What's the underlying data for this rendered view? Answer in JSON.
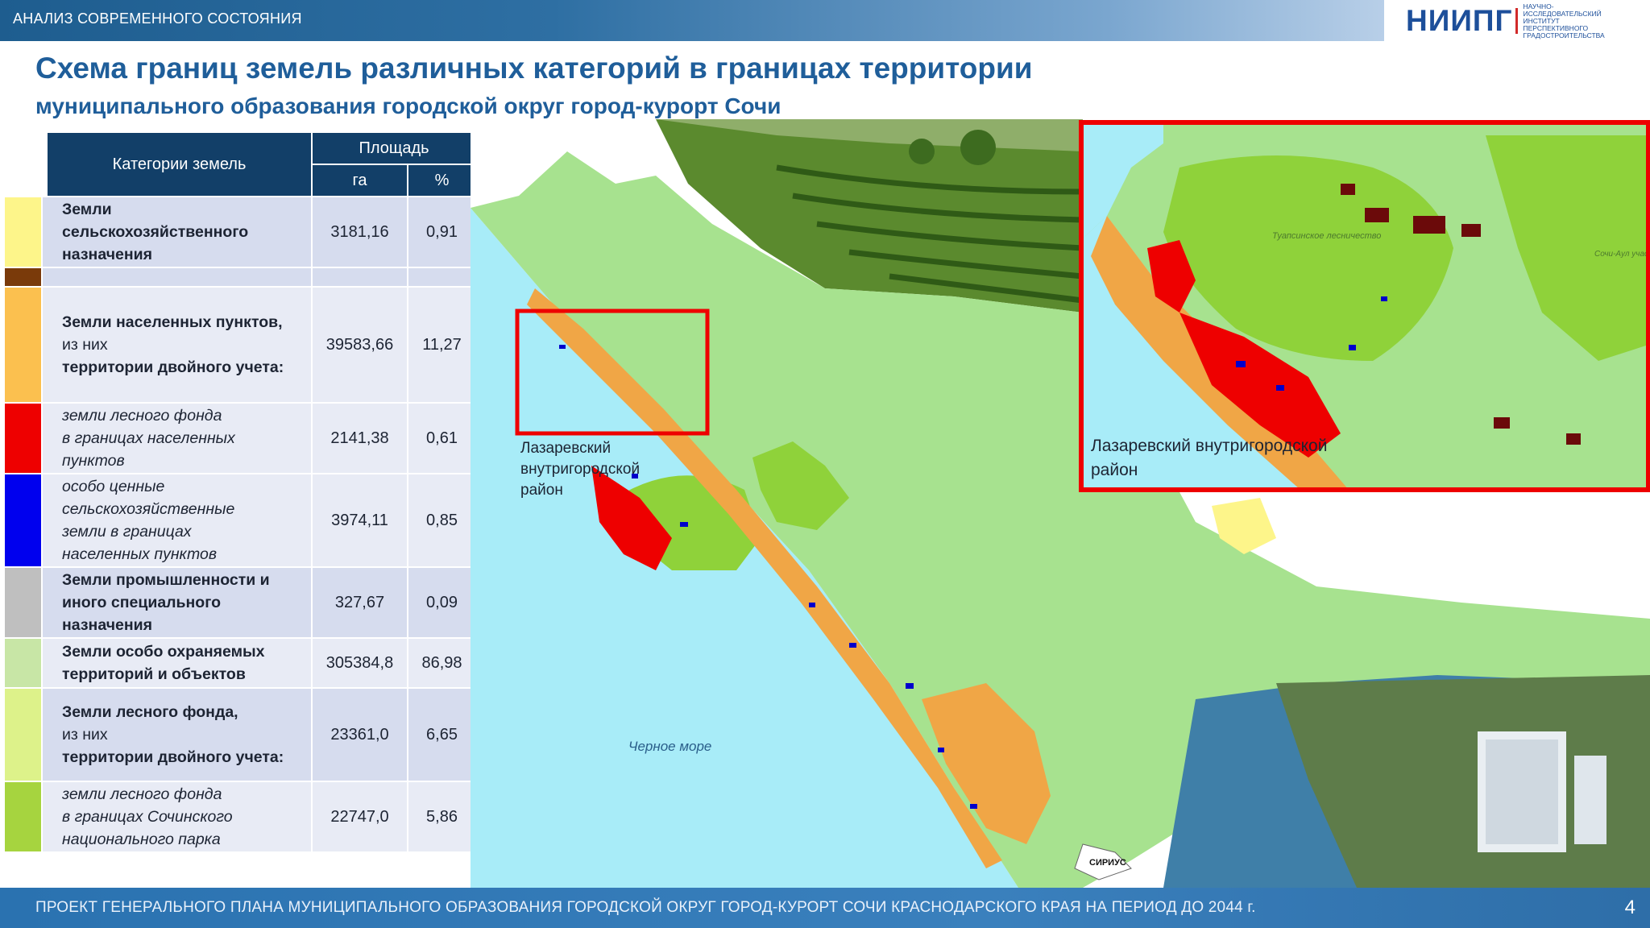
{
  "header": {
    "section": "АНАЛИЗ СОВРЕМЕННОГО СОСТОЯНИЯ",
    "logo_mark": "НИИПГ",
    "logo_desc": "НАУЧНО-ИССЛЕДОВАТЕЛЬСКИЙ ИНСТИТУТ ПЕРСПЕКТИВНОГО ГРАДОСТРОИТЕЛЬСТВА"
  },
  "title": {
    "line1": "Схема границ земель различных категорий в границах территории",
    "line2": "муниципального образования городской округ город-курорт Сочи"
  },
  "table": {
    "col_category": "Категории земель",
    "col_area": "Площадь",
    "col_ha": "га",
    "col_pct": "%",
    "rows": [
      {
        "color": "#fdf58a",
        "l1": "Земли",
        "l2": "сельскохозяйственного",
        "l3": "назначения",
        "l4": "",
        "ha": "3181,16",
        "pct": "0,91"
      },
      {
        "color": "#7a3a0a",
        "l1": "",
        "l2": "",
        "l3": "",
        "l4": "",
        "ha": "",
        "pct": ""
      },
      {
        "color": "#fbc04f",
        "l1": "Земли населенных пунктов,",
        "l2": "из них",
        "l3": "территории двойного учета:",
        "l4": "",
        "ha": "39583,66",
        "pct": "11,27"
      },
      {
        "color": "#ee0000",
        "l1": "земли лесного фонда",
        "l2": "в границах населенных",
        "l3": "пунктов",
        "l4": "",
        "ha": "2141,38",
        "pct": "0,61"
      },
      {
        "color": "#0000ee",
        "l1": "особо ценные",
        "l2": "сельскохозяйственные",
        "l3": "земли в границах",
        "l4": "населенных пунктов",
        "ha": "3974,11",
        "pct": "0,85"
      },
      {
        "color": "#bfbfbf",
        "l1": "Земли промышленности и",
        "l2": "иного специального",
        "l3": "назначения",
        "l4": "",
        "ha": "327,67",
        "pct": "0,09"
      },
      {
        "color": "#c8e6a6",
        "l1": "Земли особо охраняемых",
        "l2": "территорий и объектов",
        "l3": "",
        "l4": "",
        "ha": "305384,8",
        "pct": "86,98"
      },
      {
        "color": "#ddf28a",
        "l1": "Земли лесного фонда,",
        "l2": "из них",
        "l3": "территории двойного учета:",
        "l4": "",
        "ha": "23361,0",
        "pct": "6,65"
      },
      {
        "color": "#a6d43f",
        "l1": "земли лесного фонда",
        "l2": "в границах Сочинского",
        "l3": "национального парка",
        "l4": "",
        "ha": "22747,0",
        "pct": "5,86"
      }
    ]
  },
  "map": {
    "sea_label": "Черное море",
    "district_label_l1": "Лазаревский",
    "district_label_l2": "внутригородской",
    "district_label_l3": "район",
    "inset_label_l1": "Лазаревский внутригородской",
    "inset_label_l2": "район",
    "inset_place1": "Туапсинское лесничество",
    "inset_place2": "Сочи-Аул участковое",
    "sirius_label": "СИРИУС",
    "colors": {
      "sea": "#a8ecf8",
      "protected": "#a7e28f",
      "forest": "#8fd23a",
      "settlement": "#f0a646",
      "forest_in_settlement": "#ee0000",
      "agri_valuable": "#0000cc",
      "frame": "#ee0000"
    }
  },
  "footer": {
    "text": "ПРОЕКТ ГЕНЕРАЛЬНОГО ПЛАНА  МУНИЦИПАЛЬНОГО ОБРАЗОВАНИЯ ГОРОДСКОЙ ОКРУГ ГОРОД-КУРОРТ СОЧИ КРАСНОДАРСКОГО КРАЯ НА ПЕРИОД ДО 2044 г.",
    "page": "4"
  }
}
